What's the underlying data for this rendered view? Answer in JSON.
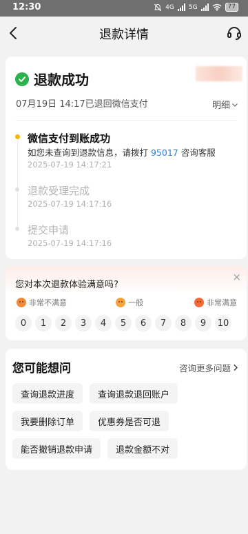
{
  "status_bar": {
    "time": "12:30",
    "network_label": "4G",
    "network2_label": "5G",
    "battery": "77"
  },
  "nav": {
    "title": "退款详情"
  },
  "refund_status": {
    "title": "退款成功",
    "subtitle": "07月19日 14:17已退回微信支付",
    "detail_label": "明细",
    "accent_color": "#2bb24c"
  },
  "timeline": [
    {
      "title": "微信支付到账成功",
      "desc_prefix": "如您未查询到退款信息，请拨打 ",
      "hotline": "95017",
      "desc_suffix": " 咨询客服",
      "time": "2025-07-19 14:17:21"
    },
    {
      "title": "退款受理完成",
      "time": "2025-07-19 14:17:16"
    },
    {
      "title": "提交申请",
      "time": "2025-07-19 14:17:16"
    }
  ],
  "rating": {
    "question": "您对本次退款体验满意吗?",
    "close_label": "×",
    "low_label": "非常不满意",
    "mid_label": "一般",
    "high_label": "非常满意",
    "scores": [
      "0",
      "1",
      "2",
      "3",
      "4",
      "5",
      "6",
      "7",
      "8",
      "9",
      "10"
    ]
  },
  "faq": {
    "title": "您可能想问",
    "more_label": "咨询更多问题",
    "chips": [
      "查询退款进度",
      "查询退款退回账户",
      "我要删除订单",
      "优惠券是否可退",
      "能否撤销退款申请",
      "退款金额不对"
    ]
  }
}
